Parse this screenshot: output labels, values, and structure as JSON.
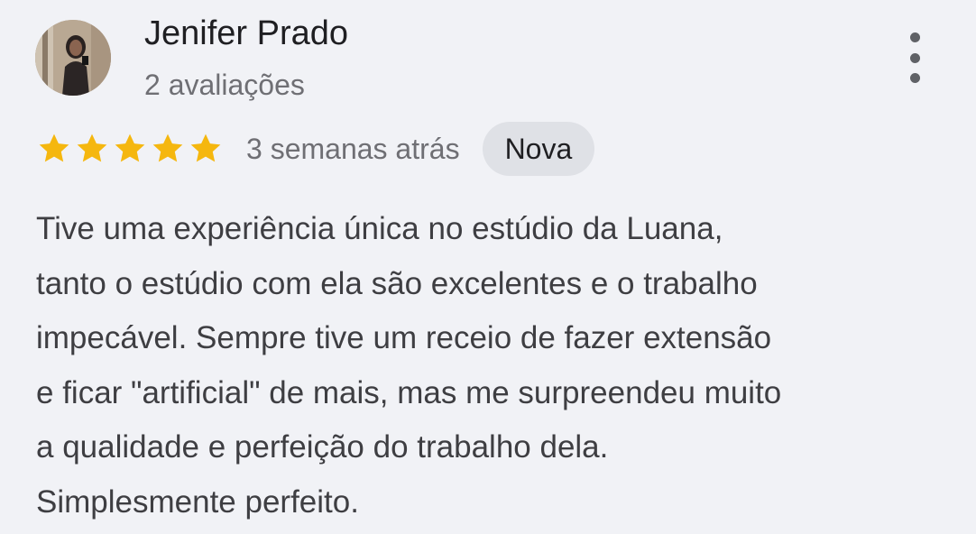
{
  "review": {
    "author": {
      "name": "Jenifer Prado",
      "review_count": "2 avaliações"
    },
    "rating": 5,
    "rating_max": 5,
    "time": "3 semanas atrás",
    "badge": "Nova",
    "text_lines": [
      "Tive uma experiência única no estúdio da Luana,",
      "tanto o estúdio com ela são excelentes e o trabalho",
      "impecável. Sempre tive um receio de fazer extensão",
      "e ficar \"artificial\" de mais, mas me surpreendeu muito",
      "a qualidade e perfeição do trabalho dela.",
      "Simplesmente perfeito."
    ]
  },
  "icons": {
    "star": "star-icon",
    "more": "more-vertical-icon"
  },
  "colors": {
    "background": "#f1f2f6",
    "star": "#f5b70f",
    "badge_background": "#dfe1e6",
    "secondary_text": "#6f6f74",
    "primary_text": "#1f1f22"
  }
}
